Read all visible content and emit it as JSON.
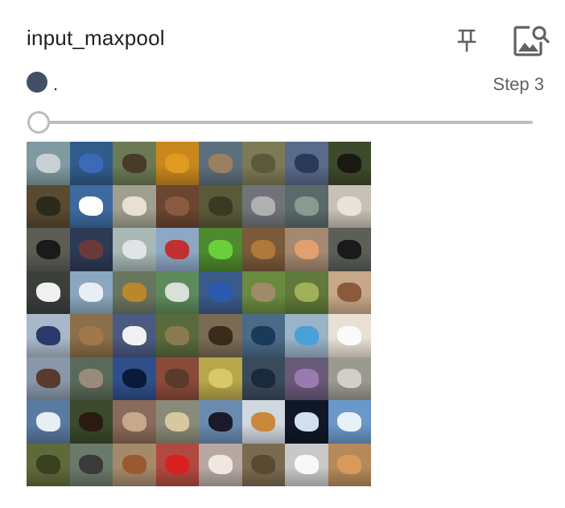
{
  "card": {
    "title": "input_maxpool",
    "pin_icon": "pin-icon",
    "image_search_icon": "image-search-icon"
  },
  "run": {
    "name": ".",
    "color": "#425066"
  },
  "step": {
    "label": "Step 3"
  },
  "slider": {
    "value_fraction": 0.0
  },
  "image": {
    "description_rows": 8,
    "description_cols": 8,
    "tiles": [
      [
        "#7f9aa0",
        "#2f5c8a",
        "#6b7a55",
        "#c8881e",
        "#5b6f7c",
        "#7d7a55",
        "#5a6a8a",
        "#3e4a2c"
      ],
      [
        "#5a4a30",
        "#3e6aa0",
        "#a0a090",
        "#6a4530",
        "#5a5a3a",
        "#707478",
        "#5a6a6a",
        "#c8c2b4"
      ],
      [
        "#5b5d55",
        "#2c3a55",
        "#a7b8b5",
        "#8da7c4",
        "#4e8a2e",
        "#7a5a3a",
        "#a58870",
        "#5a5f58"
      ],
      [
        "#3a3f3a",
        "#8aa7bf",
        "#6a7560",
        "#5d8a5a",
        "#3a5a8a",
        "#6a8a3e",
        "#5f7a3a",
        "#c8a88a"
      ],
      [
        "#a8b8c8",
        "#8a6f4a",
        "#4a5a80",
        "#5a6a3c",
        "#7a6b55",
        "#4a6a88",
        "#9ab3c6",
        "#e8e0d4"
      ],
      [
        "#8898aa",
        "#5a6a5a",
        "#2f4f8a",
        "#8a4a3a",
        "#b7a74a",
        "#3a4a5a",
        "#6a5a7a",
        "#9a9a90"
      ],
      [
        "#5a7aa0",
        "#3a4a2a",
        "#8a6a5a",
        "#8a8a78",
        "#6a8ab0",
        "#d0d8e0",
        "#101828",
        "#6a98c8"
      ],
      [
        "#5f6a3a",
        "#6a7a6a",
        "#a58a6a",
        "#b04a40",
        "#b8a8a4",
        "#7a6a50",
        "#c8c8c8",
        "#b48a5a"
      ]
    ],
    "subjects": [
      [
        "#c8d0d4",
        "#3b6ab8",
        "#4a3a2a",
        "#e09a20",
        "#9a8060",
        "#5a5a3a",
        "#2a3a5a",
        "#1a1a12"
      ],
      [
        "#2a2a1a",
        "#ffffff",
        "#e8e0d0",
        "#8a5a40",
        "#3a3a24",
        "#b0b0b0",
        "#8a9a90",
        "#e8e4dc"
      ],
      [
        "#1a1a1a",
        "#6a3a3a",
        "#e0e4e4",
        "#c03030",
        "#6ad03a",
        "#b0783a",
        "#e0a070",
        "#1a1a1a"
      ],
      [
        "#f0f0f0",
        "#e8eef4",
        "#b8882a",
        "#d8e0d8",
        "#2a5ab0",
        "#a08a6a",
        "#a0b05a",
        "#8a5a3a"
      ],
      [
        "#2a3a6a",
        "#a0784a",
        "#f0f0f0",
        "#8a7a50",
        "#3a2a1a",
        "#1a3a5a",
        "#4aa0d8",
        "#fafafa"
      ],
      [
        "#5a3a2a",
        "#9a8a7a",
        "#0a1a3a",
        "#5a3a2a",
        "#d8c86a",
        "#1a2a3a",
        "#9a7ab0",
        "#d0d0c8"
      ],
      [
        "#e8eef4",
        "#2a1a10",
        "#c8a88a",
        "#d8c8a0",
        "#1a1a2a",
        "#c88a3a",
        "#d0e0f0",
        "#e8f0f8"
      ],
      [
        "#3a4020",
        "#3a3a3a",
        "#9a5a30",
        "#d82020",
        "#f0e8e0",
        "#5a4a30",
        "#f8f8f8",
        "#d89a5a"
      ]
    ]
  }
}
